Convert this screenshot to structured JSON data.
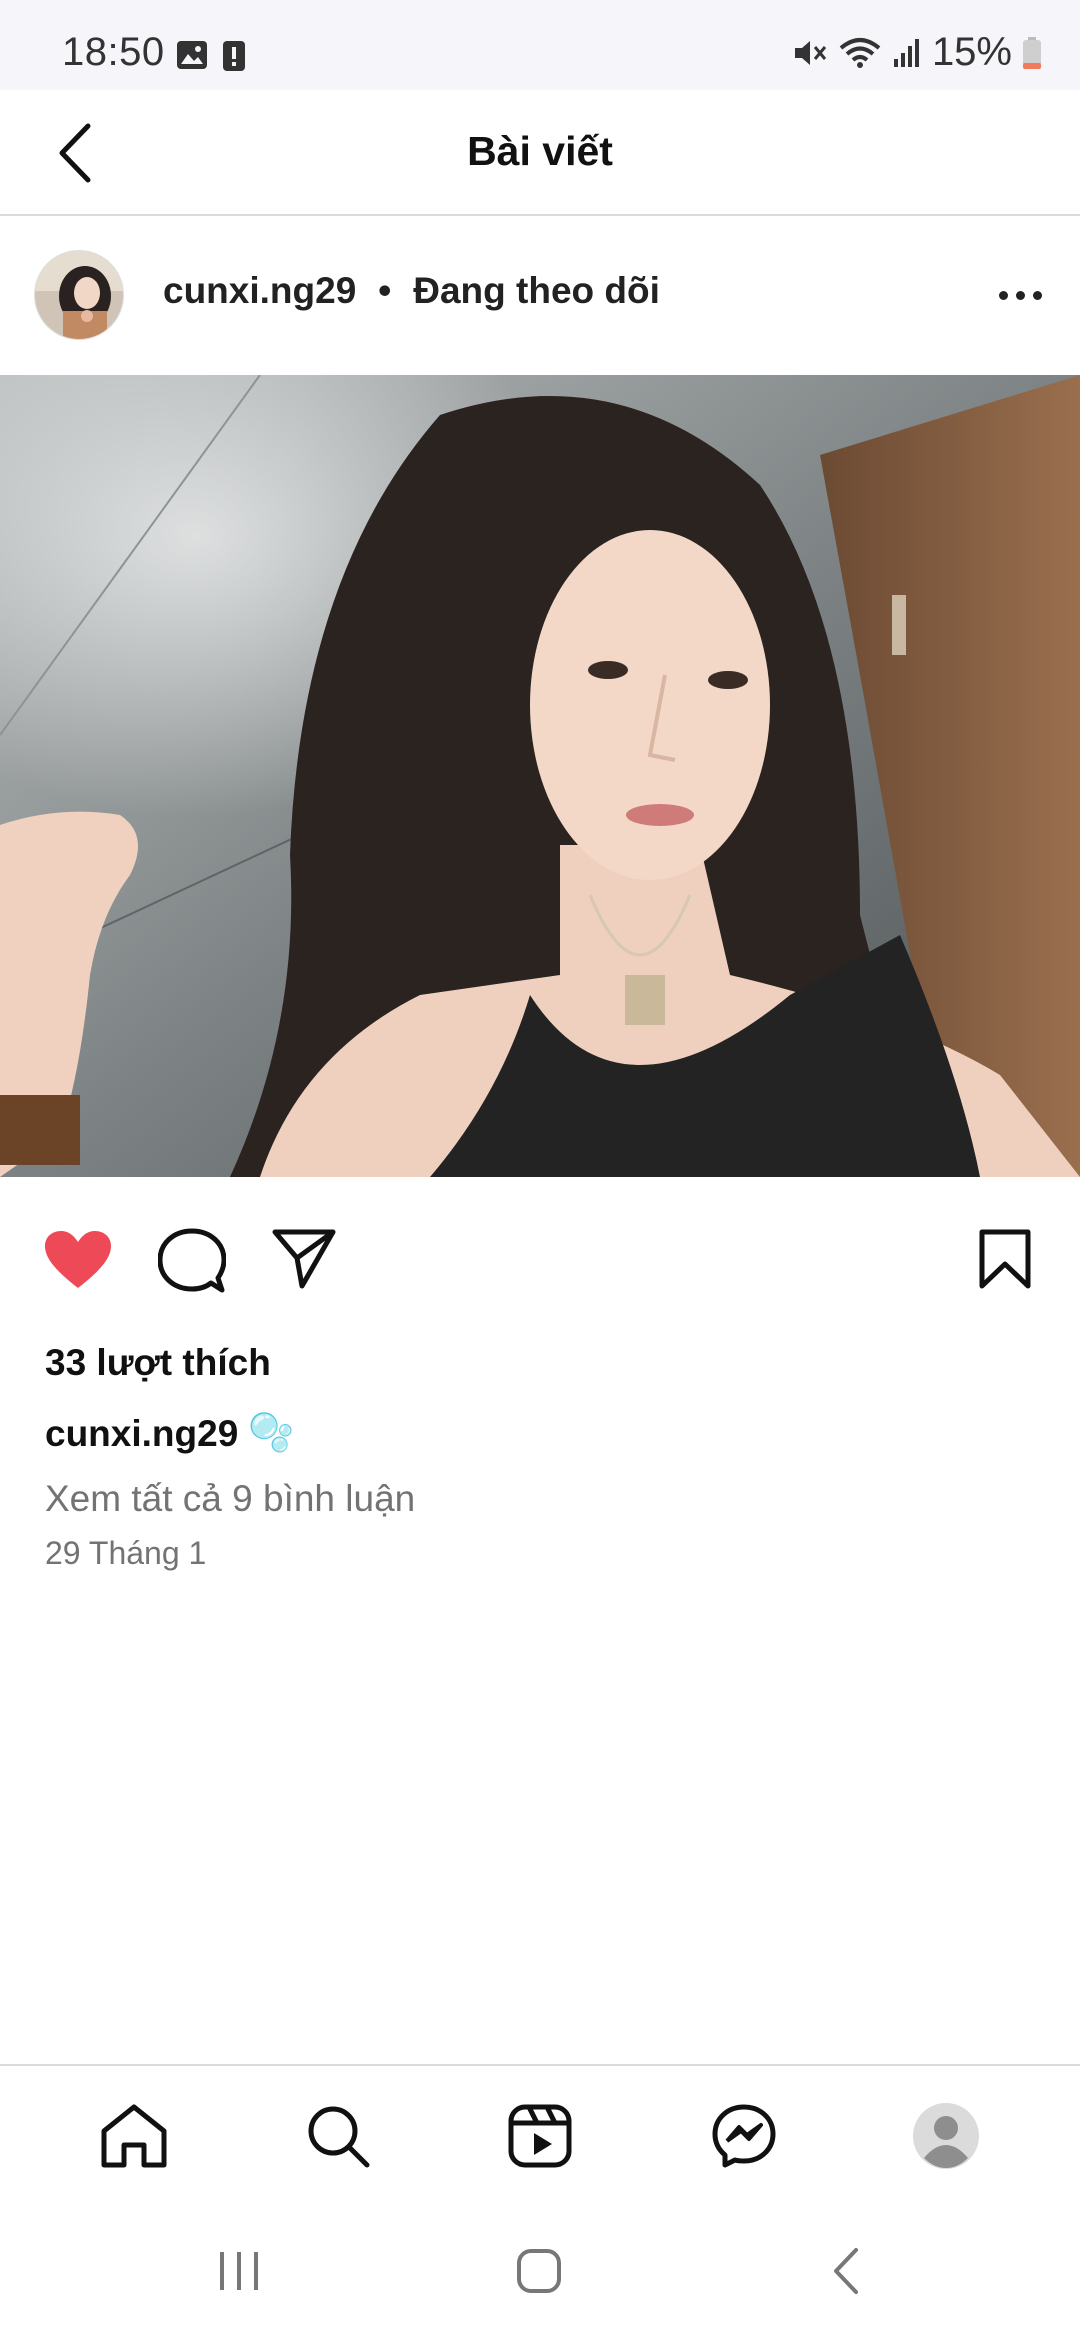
{
  "status_bar": {
    "time": "18:50",
    "battery": "15%",
    "left_icons": [
      "gallery-icon",
      "alert-icon"
    ],
    "right_icons": [
      "mute-icon",
      "wifi-icon",
      "signal-icon",
      "battery-icon"
    ]
  },
  "header": {
    "title": "Bài viết",
    "back_icon": "back-arrow-icon"
  },
  "post": {
    "username": "cunxi.ng29",
    "separator": "•",
    "follow_status": "Đang theo dõi",
    "likes": "33 lượt thích",
    "caption_user": "cunxi.ng29",
    "caption_emoji": "🫧",
    "view_comments": "Xem tất cả 9 bình luận",
    "date": "29 Tháng 1",
    "liked": true,
    "accent_like": "#ed4956"
  },
  "bottom_nav": [
    "home-icon",
    "search-icon",
    "reels-icon",
    "messenger-icon",
    "profile-icon"
  ]
}
